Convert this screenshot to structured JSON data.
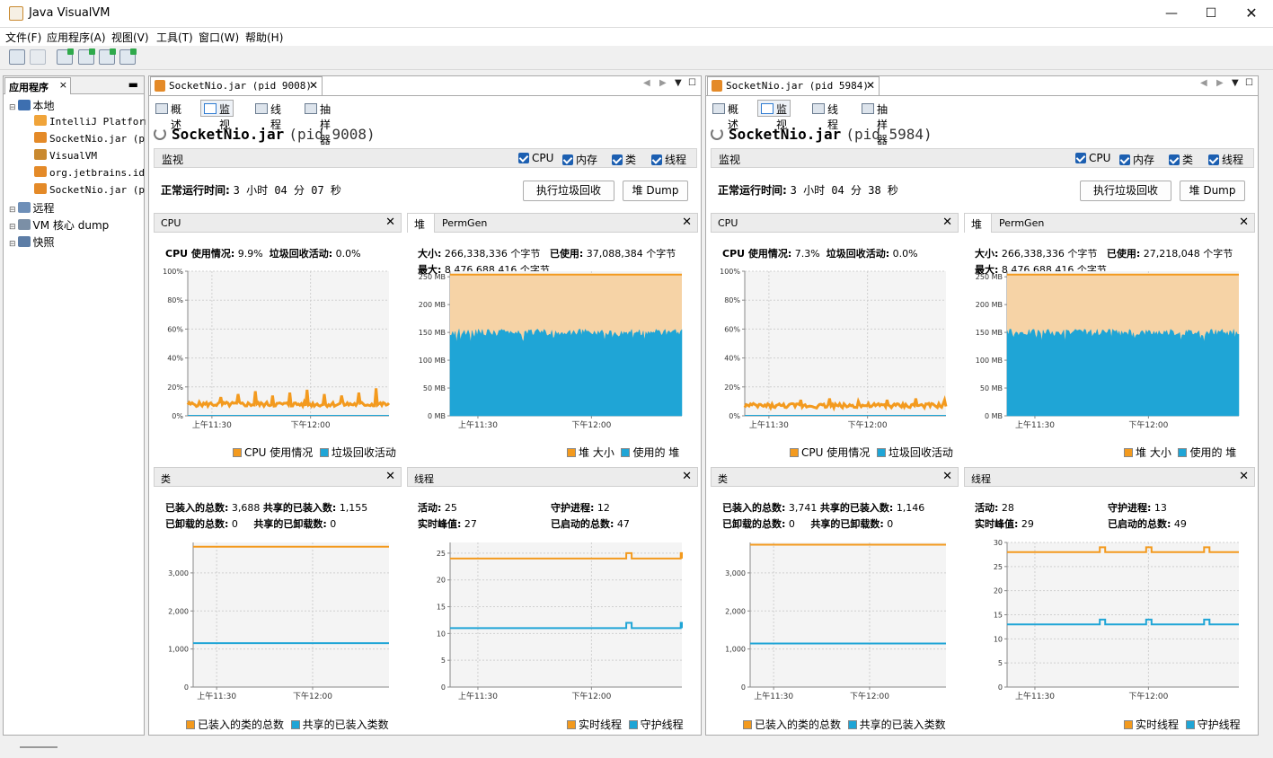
{
  "window": {
    "title": "Java VisualVM",
    "controls": [
      "minimize-icon",
      "maximize-icon",
      "close-icon"
    ]
  },
  "menu": [
    "文件(F)",
    "应用程序(A)",
    "视图(V)",
    "工具(T)",
    "窗口(W)",
    "帮助(H)"
  ],
  "left_panel": {
    "tab": "应用程序",
    "close": "×",
    "minimize": "▬",
    "tree": [
      {
        "label": "本地",
        "level": 0,
        "icon": "computer-icon"
      },
      {
        "label": "IntelliJ Platform",
        "level": 2,
        "icon": "intellij-icon"
      },
      {
        "label": "SocketNio.jar (p",
        "level": 2,
        "icon": "java-icon"
      },
      {
        "label": "VisualVM",
        "level": 2,
        "icon": "visualvm-icon"
      },
      {
        "label": "org.jetbrains.id",
        "level": 2,
        "icon": "java-icon"
      },
      {
        "label": "SocketNio.jar (p",
        "level": 2,
        "icon": "java-icon"
      },
      {
        "label": "远程",
        "level": 0,
        "icon": "network-icon"
      },
      {
        "label": "VM 核心 dump",
        "level": 0,
        "icon": "coredump-icon"
      },
      {
        "label": "快照",
        "level": 0,
        "icon": "snapshot-icon"
      }
    ]
  },
  "colors": {
    "orange": "#f39a1e",
    "blue": "#1fa5d6",
    "orange_fill": "#f6d3a6",
    "grid": "#d0d0d0"
  },
  "apps": [
    {
      "tab": "SocketNio.jar (pid 9008)",
      "subtabs": [
        "概述",
        "监视",
        "线程",
        "抽样器"
      ],
      "title": "SocketNio.jar",
      "pid": "(pid 9008)",
      "monitor_label": "监视",
      "checkboxes": [
        "CPU",
        "内存",
        "类",
        "线程"
      ],
      "uptime_label": "正常运行时间:",
      "uptime": "3 小时 04 分 07 秒",
      "gc_button": "执行垃圾回收",
      "dump_button": "堆 Dump",
      "cpu": {
        "title": "CPU",
        "usage_label": "CPU 使用情况:",
        "usage": "9.9%",
        "gc_label": "垃圾回收活动:",
        "gc": "0.0%",
        "legend": [
          "CPU 使用情况",
          "垃圾回收活动"
        ]
      },
      "heap": {
        "tab1": "堆",
        "tab2": "PermGen",
        "size_label": "大小:",
        "size": "266,338,336 个字节",
        "used_label": "已使用:",
        "used": "37,088,384 个字节",
        "max_label": "最大:",
        "max": "8,476,688,416 个字节",
        "legend": [
          "堆 大小",
          "使用的 堆"
        ]
      },
      "classes": {
        "title": "类",
        "loaded_label": "已装入的总数:",
        "loaded": "3,688",
        "shared_loaded_label": "共享的已装入数:",
        "shared_loaded": "1,155",
        "unloaded_label": "已卸载的总数:",
        "unloaded": "0",
        "shared_unloaded_label": "共享的已卸载数:",
        "shared_unloaded": "0",
        "legend": [
          "已装入的类的总数",
          "共享的已装入类数"
        ]
      },
      "threads": {
        "title": "线程",
        "live_label": "活动:",
        "live": "25",
        "daemon_label": "守护进程:",
        "daemon": "12",
        "peak_label": "实时峰值:",
        "peak": "27",
        "started_label": "已启动的总数:",
        "started": "47",
        "legend": [
          "实时线程",
          "守护线程"
        ]
      }
    },
    {
      "tab": "SocketNio.jar (pid 5984)",
      "subtabs": [
        "概述",
        "监视",
        "线程",
        "抽样器"
      ],
      "title": "SocketNio.jar",
      "pid": "(pid 5984)",
      "monitor_label": "监视",
      "checkboxes": [
        "CPU",
        "内存",
        "类",
        "线程"
      ],
      "uptime_label": "正常运行时间:",
      "uptime": "3 小时 04 分 38 秒",
      "gc_button": "执行垃圾回收",
      "dump_button": "堆 Dump",
      "cpu": {
        "title": "CPU",
        "usage_label": "CPU 使用情况:",
        "usage": "7.3%",
        "gc_label": "垃圾回收活动:",
        "gc": "0.0%",
        "legend": [
          "CPU 使用情况",
          "垃圾回收活动"
        ]
      },
      "heap": {
        "tab1": "堆",
        "tab2": "PermGen",
        "size_label": "大小:",
        "size": "266,338,336 个字节",
        "used_label": "已使用:",
        "used": "27,218,048 个字节",
        "max_label": "最大:",
        "max": "8,476,688,416 个字节",
        "legend": [
          "堆 大小",
          "使用的 堆"
        ]
      },
      "classes": {
        "title": "类",
        "loaded_label": "已装入的总数:",
        "loaded": "3,741",
        "shared_loaded_label": "共享的已装入数:",
        "shared_loaded": "1,146",
        "unloaded_label": "已卸载的总数:",
        "unloaded": "0",
        "shared_unloaded_label": "共享的已卸载数:",
        "shared_unloaded": "0",
        "legend": [
          "已装入的类的总数",
          "共享的已装入类数"
        ]
      },
      "threads": {
        "title": "线程",
        "live_label": "活动:",
        "live": "28",
        "daemon_label": "守护进程:",
        "daemon": "13",
        "peak_label": "实时峰值:",
        "peak": "29",
        "started_label": "已启动的总数:",
        "started": "49",
        "legend": [
          "实时线程",
          "守护线程"
        ]
      }
    }
  ],
  "chart_data": [
    {
      "app": 0,
      "name": "cpu",
      "type": "line",
      "ylim": [
        0,
        100
      ],
      "yticks": [
        "0%",
        "20%",
        "40%",
        "60%",
        "80%",
        "100%"
      ],
      "xticks": [
        "上午11:30",
        "下午12:00"
      ],
      "series": [
        {
          "name": "CPU 使用情况",
          "level": 8,
          "spikes": [
            13,
            15,
            17,
            14,
            16,
            18,
            15,
            14,
            16,
            19
          ]
        },
        {
          "name": "垃圾回收活动",
          "level": 0
        }
      ]
    },
    {
      "app": 0,
      "name": "heap",
      "type": "area",
      "ylim": [
        0,
        260
      ],
      "yticks": [
        "0 MB",
        "50 MB",
        "100 MB",
        "150 MB",
        "200 MB",
        "250 MB"
      ],
      "xticks": [
        "上午11:30",
        "下午12:00"
      ],
      "series": [
        {
          "name": "堆 大小",
          "level": 254
        },
        {
          "name": "使用的 堆",
          "level": 150
        }
      ]
    },
    {
      "app": 0,
      "name": "classes",
      "type": "line",
      "ylim": [
        0,
        3800
      ],
      "yticks": [
        "0",
        "1,000",
        "2,000",
        "3,000"
      ],
      "xticks": [
        "上午11:30",
        "下午12:00"
      ],
      "series": [
        {
          "name": "已装入的类的总数",
          "level": 3688
        },
        {
          "name": "共享的已装入类数",
          "level": 1155
        }
      ]
    },
    {
      "app": 0,
      "name": "threads",
      "type": "line",
      "ylim": [
        0,
        27
      ],
      "yticks": [
        "0",
        "5",
        "10",
        "15",
        "20",
        "25"
      ],
      "xticks": [
        "上午11:30",
        "下午12:00"
      ],
      "series": [
        {
          "name": "实时线程",
          "level": 24,
          "bumps": [
            0.76,
            0.995
          ]
        },
        {
          "name": "守护线程",
          "level": 11,
          "bumps": [
            0.76,
            0.995
          ]
        }
      ]
    },
    {
      "app": 1,
      "name": "cpu",
      "type": "line",
      "ylim": [
        0,
        100
      ],
      "yticks": [
        "0%",
        "20%",
        "40%",
        "60%",
        "80%",
        "100%"
      ],
      "xticks": [
        "上午11:30",
        "下午12:00"
      ],
      "series": [
        {
          "name": "CPU 使用情况",
          "level": 7,
          "spikes": [
            11,
            12,
            10,
            11,
            12,
            11
          ]
        },
        {
          "name": "垃圾回收活动",
          "level": 0
        }
      ]
    },
    {
      "app": 1,
      "name": "heap",
      "type": "area",
      "ylim": [
        0,
        260
      ],
      "yticks": [
        "0 MB",
        "50 MB",
        "100 MB",
        "150 MB",
        "200 MB",
        "250 MB"
      ],
      "xticks": [
        "上午11:30",
        "下午12:00"
      ],
      "series": [
        {
          "name": "堆 大小",
          "level": 254
        },
        {
          "name": "使用的 堆",
          "level": 150
        }
      ]
    },
    {
      "app": 1,
      "name": "classes",
      "type": "line",
      "ylim": [
        0,
        3800
      ],
      "yticks": [
        "0",
        "1,000",
        "2,000",
        "3,000"
      ],
      "xticks": [
        "上午11:30",
        "下午12:00"
      ],
      "series": [
        {
          "name": "已装入的类的总数",
          "level": 3741
        },
        {
          "name": "共享的已装入类数",
          "level": 1146
        }
      ]
    },
    {
      "app": 1,
      "name": "threads",
      "type": "line",
      "ylim": [
        0,
        30
      ],
      "yticks": [
        "0",
        "5",
        "10",
        "15",
        "20",
        "25",
        "30"
      ],
      "xticks": [
        "上午11:30",
        "下午12:00"
      ],
      "series": [
        {
          "name": "实时线程",
          "level": 28,
          "bumps": [
            0.4,
            0.6,
            0.85
          ]
        },
        {
          "name": "守护线程",
          "level": 13,
          "bumps": [
            0.4,
            0.6,
            0.85
          ]
        }
      ]
    }
  ]
}
